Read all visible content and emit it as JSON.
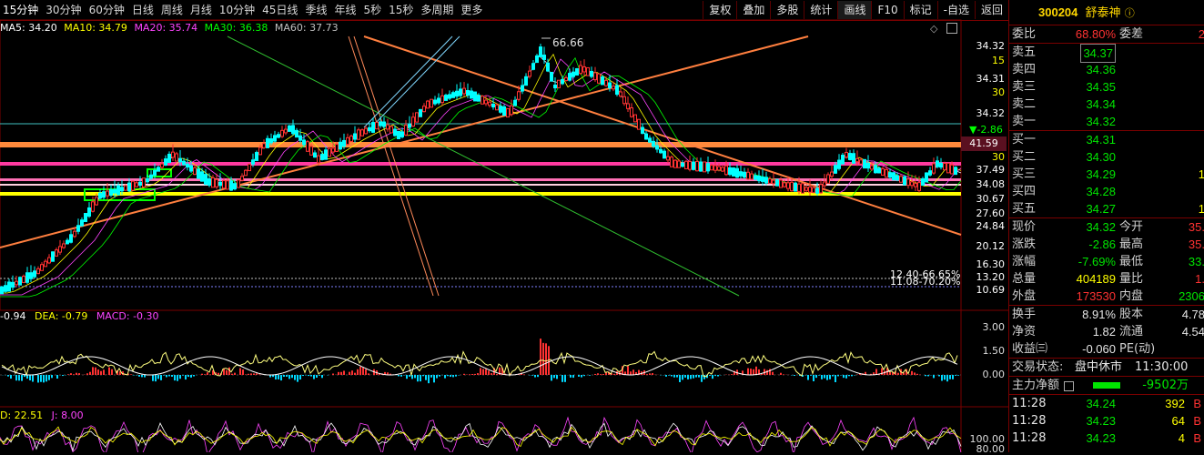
{
  "toolbar": {
    "timeframes": [
      "15分钟",
      "30分钟",
      "60分钟",
      "日线",
      "周线",
      "月线",
      "10分钟",
      "45日线",
      "季线",
      "年线",
      "5秒",
      "15秒",
      "多周期",
      "更多"
    ],
    "tools": [
      "复权",
      "叠加",
      "多股",
      "统计",
      "画线",
      "F10",
      "标记",
      "-自选",
      "返回"
    ]
  },
  "ma": {
    "ma5": "MA5: 34.20",
    "ma10": "MA10: 34.79",
    "ma20": "MA20: 35.74",
    "ma30": "MA30: 36.38",
    "ma60": "MA60: 37.73",
    "colors": {
      "ma5": "#ffffff",
      "ma10": "#ffff00",
      "ma20": "#ff00ff",
      "ma30": "#00ff00",
      "ma60": "#c0c0c0"
    }
  },
  "price_chart": {
    "high_label": "66.66",
    "current_price_tag": "41.59",
    "change_tag": "▼-2.86",
    "annotations": [
      "12.40-66.65%",
      "11.08-70.20%"
    ],
    "y_labels": [
      "34.32",
      "15",
      "34.31",
      "30",
      "34.32",
      "30",
      "37.49",
      "34.08",
      "30.67",
      "27.60",
      "24.84",
      "20.12",
      "16.30",
      "13.20",
      "10.69"
    ]
  },
  "macd": {
    "dif": "-0.94",
    "dea": "DEA: -0.79",
    "macd": "MACD: -0.30",
    "y_labels": [
      "3.00",
      "1.50",
      "0.00"
    ]
  },
  "kdj": {
    "d": "D: 22.51",
    "j": "J: 8.00",
    "y_labels": [
      "100.00",
      "80.00"
    ]
  },
  "stock": {
    "code": "300204",
    "name": "舒泰神",
    "weibi_label": "委比",
    "weibi": "68.80%",
    "weicha_label": "委差",
    "weicha": "2",
    "sell": [
      {
        "label": "卖五",
        "price": "34.37"
      },
      {
        "label": "卖四",
        "price": "34.36"
      },
      {
        "label": "卖三",
        "price": "34.35"
      },
      {
        "label": "卖二",
        "price": "34.34"
      },
      {
        "label": "卖一",
        "price": "34.32"
      }
    ],
    "buy": [
      {
        "label": "买一",
        "price": "34.31",
        "vol": ""
      },
      {
        "label": "买二",
        "price": "34.30",
        "vol": ""
      },
      {
        "label": "买三",
        "price": "34.29",
        "vol": "1"
      },
      {
        "label": "买四",
        "price": "34.28",
        "vol": ""
      },
      {
        "label": "买五",
        "price": "34.27",
        "vol": "1"
      }
    ],
    "quote": [
      {
        "l1": "现价",
        "v1": "34.32",
        "l2": "今开",
        "v2": "35."
      },
      {
        "l1": "涨跌",
        "v1": "-2.86",
        "l2": "最高",
        "v2": "35."
      },
      {
        "l1": "涨幅",
        "v1": "-7.69%",
        "l2": "最低",
        "v2": "33."
      },
      {
        "l1": "总量",
        "v1": "404189",
        "l2": "量比",
        "v2": "1."
      },
      {
        "l1": "外盘",
        "v1": "173530",
        "l2": "内盘",
        "v2": "2306"
      }
    ],
    "finance": [
      {
        "l1": "换手",
        "v1": "8.91%",
        "l2": "股本",
        "v2": "4.78"
      },
      {
        "l1": "净资",
        "v1": "1.82",
        "l2": "流通",
        "v2": "4.54"
      },
      {
        "l1": "收益㈢",
        "v1": "-0.060",
        "l2": "PE(动)",
        "v2": ""
      }
    ],
    "status_label": "交易状态:",
    "status": "盘中休市",
    "status_time": "11:30:00",
    "flow_label": "主力净额",
    "flow_value": "-9502万",
    "ticks": [
      {
        "time": "11:28",
        "price": "34.24",
        "vol": "392",
        "side": "B"
      },
      {
        "time": "11:28",
        "price": "34.23",
        "vol": "64",
        "side": "B"
      },
      {
        "time": "11:28",
        "price": "34.23",
        "vol": "4",
        "side": "B"
      }
    ]
  }
}
